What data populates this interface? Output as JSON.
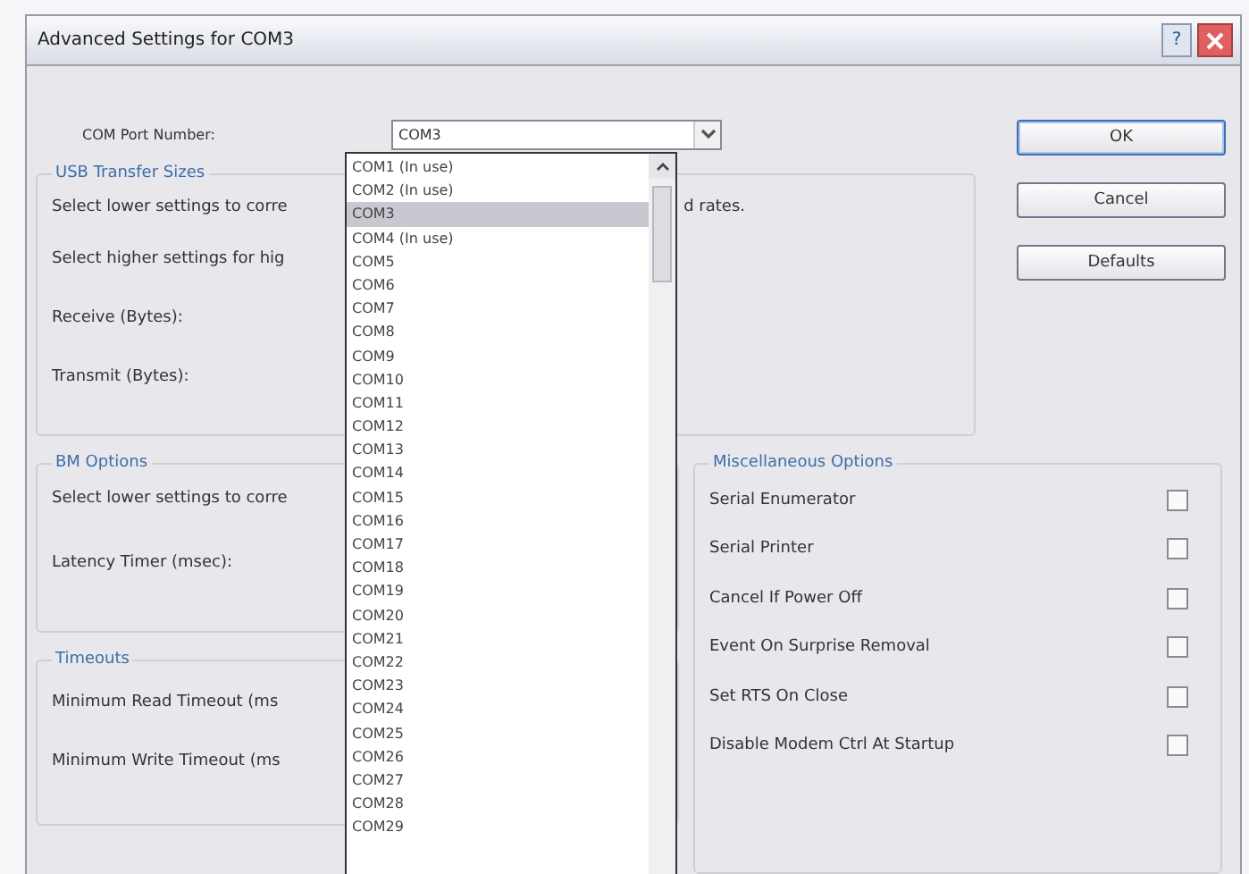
{
  "window": {
    "title": "Advanced Settings for COM3",
    "help": "?"
  },
  "com_port": {
    "label": "COM Port Number:",
    "value": "COM3"
  },
  "port_list": [
    {
      "label": "COM1 (In use)",
      "selected": false
    },
    {
      "label": "COM2 (In use)",
      "selected": false
    },
    {
      "label": "COM3",
      "selected": true
    },
    {
      "label": "COM4 (In use)",
      "selected": false
    },
    {
      "label": "COM5",
      "selected": false
    },
    {
      "label": "COM6",
      "selected": false
    },
    {
      "label": "COM7",
      "selected": false
    },
    {
      "label": "COM8",
      "selected": false
    },
    {
      "label": "COM9",
      "selected": false
    },
    {
      "label": "COM10",
      "selected": false
    },
    {
      "label": "COM11",
      "selected": false
    },
    {
      "label": "COM12",
      "selected": false
    },
    {
      "label": "COM13",
      "selected": false
    },
    {
      "label": "COM14",
      "selected": false
    },
    {
      "label": "COM15",
      "selected": false
    },
    {
      "label": "COM16",
      "selected": false
    },
    {
      "label": "COM17",
      "selected": false
    },
    {
      "label": "COM18",
      "selected": false
    },
    {
      "label": "COM19",
      "selected": false
    },
    {
      "label": "COM20",
      "selected": false
    },
    {
      "label": "COM21",
      "selected": false
    },
    {
      "label": "COM22",
      "selected": false
    },
    {
      "label": "COM23",
      "selected": false
    },
    {
      "label": "COM24",
      "selected": false
    },
    {
      "label": "COM25",
      "selected": false
    },
    {
      "label": "COM26",
      "selected": false
    },
    {
      "label": "COM27",
      "selected": false
    },
    {
      "label": "COM28",
      "selected": false
    },
    {
      "label": "COM29",
      "selected": false
    }
  ],
  "usb_transfer_sizes": {
    "title": "USB Transfer Sizes",
    "note_lower": "Select lower settings to corre",
    "note_lower_end": "d rates.",
    "note_higher": "Select higher settings for hig",
    "receive_label": "Receive (Bytes):",
    "transmit_label": "Transmit (Bytes):"
  },
  "bm_options": {
    "title": "BM Options",
    "note": "Select lower settings to corre",
    "latency_label": "Latency Timer (msec):"
  },
  "timeouts": {
    "title": "Timeouts",
    "read_label": "Minimum Read Timeout (ms",
    "write_label": "Minimum Write Timeout (ms"
  },
  "misc_options": {
    "title": "Miscellaneous Options",
    "items": [
      {
        "label": "Serial Enumerator",
        "checked": false
      },
      {
        "label": "Serial Printer",
        "checked": false
      },
      {
        "label": "Cancel If Power Off",
        "checked": false
      },
      {
        "label": "Event On Surprise Removal",
        "checked": false
      },
      {
        "label": "Set RTS On Close",
        "checked": false
      },
      {
        "label": "Disable Modem Ctrl At Startup",
        "checked": false
      }
    ]
  },
  "buttons": [
    "OK",
    "Cancel",
    "Defaults"
  ]
}
